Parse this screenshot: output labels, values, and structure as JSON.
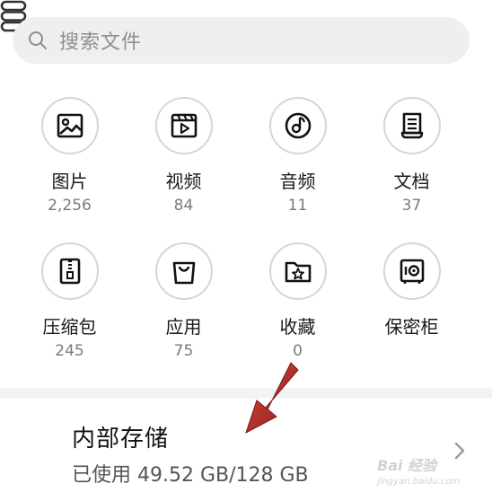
{
  "search": {
    "placeholder": "搜索文件"
  },
  "categories": [
    {
      "label": "图片",
      "count": "2,256",
      "icon": "image-icon"
    },
    {
      "label": "视频",
      "count": "84",
      "icon": "video-icon"
    },
    {
      "label": "音频",
      "count": "11",
      "icon": "audio-icon"
    },
    {
      "label": "文档",
      "count": "37",
      "icon": "document-icon"
    },
    {
      "label": "压缩包",
      "count": "245",
      "icon": "archive-icon"
    },
    {
      "label": "应用",
      "count": "75",
      "icon": "app-bag-icon"
    },
    {
      "label": "收藏",
      "count": "0",
      "icon": "favorite-folder-icon"
    },
    {
      "label": "保密柜",
      "count": "",
      "icon": "safe-icon"
    }
  ],
  "storage": {
    "title": "内部存储",
    "used": "已使用 49.52 GB/128 GB",
    "icon": "storage-icon"
  },
  "watermark": {
    "text": "Bai 经验",
    "sub": "jingyan.baidu.com"
  },
  "colors": {
    "accent_arrow": "#b22222",
    "circle_border": "#d6d6d6",
    "search_bg": "#efefef"
  }
}
